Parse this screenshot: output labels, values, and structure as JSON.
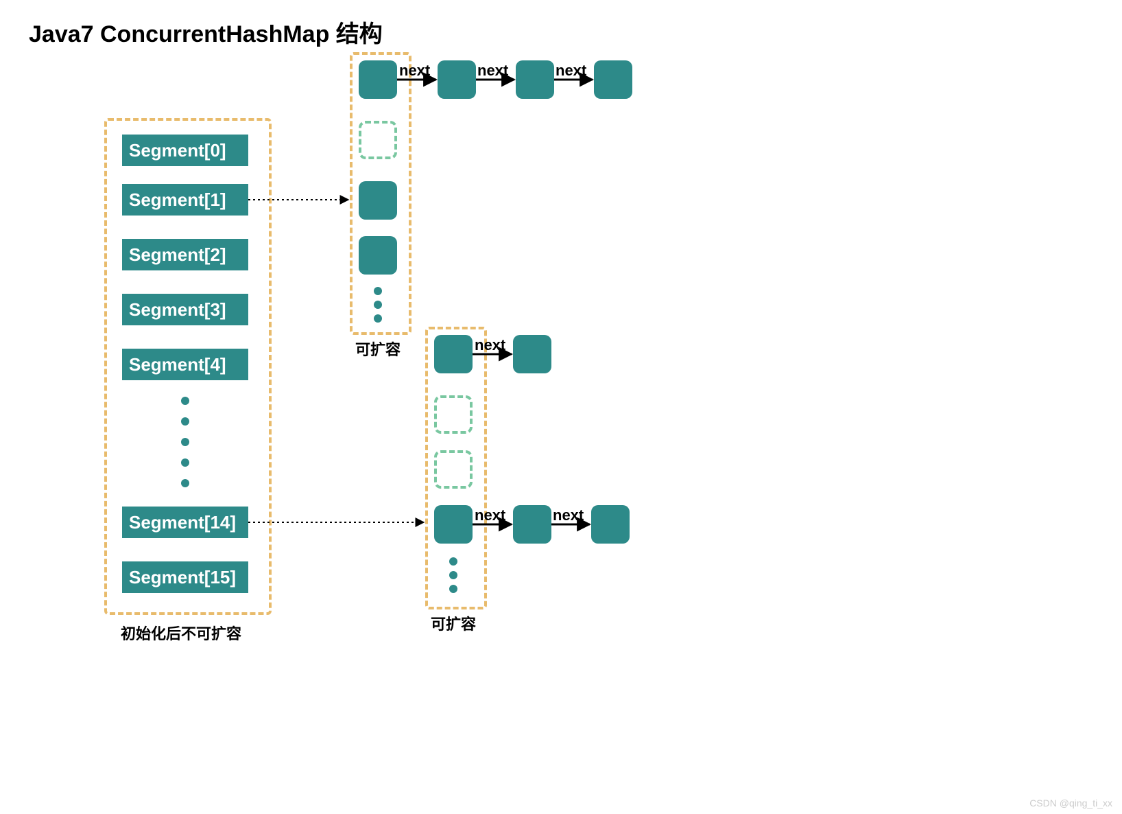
{
  "title": "Java7 ConcurrentHashMap 结构",
  "segments": {
    "s0": "Segment[0]",
    "s1": "Segment[1]",
    "s2": "Segment[2]",
    "s3": "Segment[3]",
    "s4": "Segment[4]",
    "s14": "Segment[14]",
    "s15": "Segment[15]"
  },
  "labels": {
    "next": "next",
    "expandable": "可扩容",
    "not_expandable": "初始化后不可扩容"
  },
  "watermark": "CSDN @qing_ti_xx",
  "colors": {
    "teal": "#2d8a89",
    "orange_dash": "#e8bb6c",
    "green_dash": "#79c7a0"
  }
}
